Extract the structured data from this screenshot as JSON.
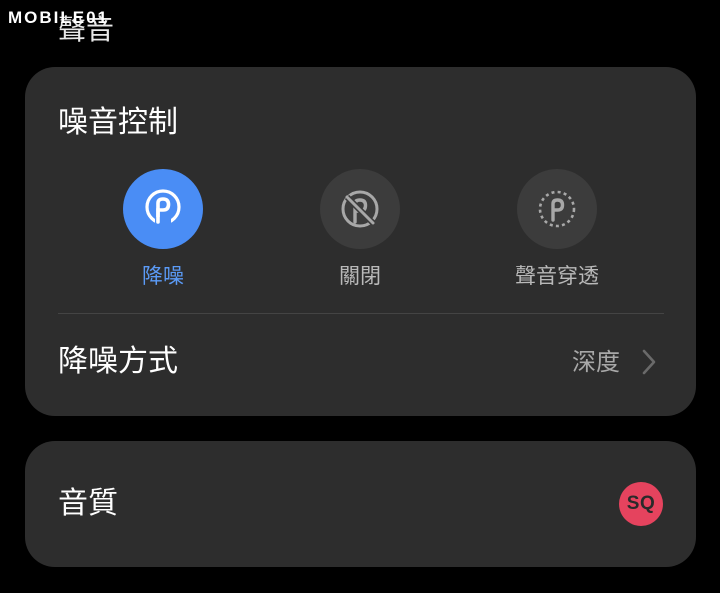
{
  "watermark": {
    "text": "MOBILE01"
  },
  "section_title": "聲音",
  "noise_control": {
    "heading": "噪音控制",
    "modes": [
      {
        "label": "降噪",
        "icon": "noise-cancelling-icon",
        "active": true
      },
      {
        "label": "關閉",
        "icon": "anc-off-icon",
        "active": false
      },
      {
        "label": "聲音穿透",
        "icon": "ambient-sound-icon",
        "active": false
      }
    ],
    "method": {
      "label": "降噪方式",
      "value": "深度"
    }
  },
  "audio_quality": {
    "label": "音質",
    "badge": "SQ"
  },
  "colors": {
    "background": "#000000",
    "card": "#2d2d2d",
    "accent": "#4a8df5",
    "badge": "#e5435e"
  }
}
